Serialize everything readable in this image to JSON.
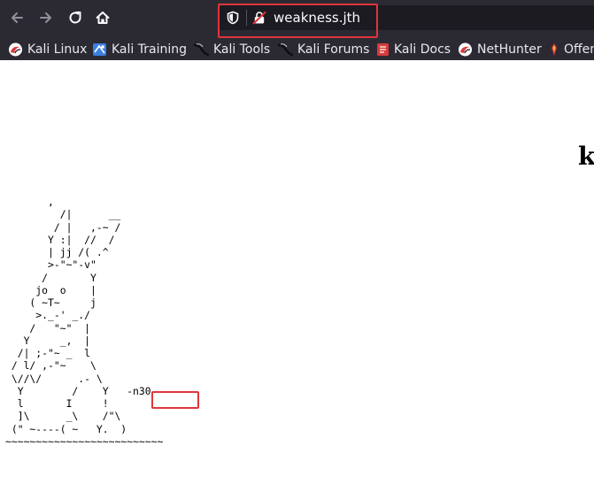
{
  "browser": {
    "nav": {
      "back_icon": "arrow-left-icon",
      "forward_icon": "arrow-right-icon",
      "reload_icon": "reload-icon",
      "home_icon": "home-icon"
    },
    "url_bar": {
      "url": "weakness.jth",
      "shield_icon": "shield-icon",
      "lock_icon": "insecure-lock-icon"
    },
    "bookmarks": [
      {
        "label": "Kali Linux",
        "icon": "kali-logo-icon"
      },
      {
        "label": "Kali Training",
        "icon": "kali-training-icon"
      },
      {
        "label": "Kali Tools",
        "icon": "kali-dragon-icon"
      },
      {
        "label": "Kali Forums",
        "icon": "kali-dragon-icon"
      },
      {
        "label": "Kali Docs",
        "icon": "kali-docs-icon"
      },
      {
        "label": "NetHunter",
        "icon": "kali-logo-icon"
      },
      {
        "label": "Offensive Security",
        "icon": "offsec-icon"
      }
    ],
    "colors": {
      "chrome_bg": "#2b2a33",
      "url_bg": "#1c1b22",
      "highlight": "#e0353b"
    }
  },
  "page": {
    "heading": "k",
    "ascii_art": "       ,\n         /|      __\n        / |   ,-~ /\n       Y :|  //  /\n       | jj /( .^\n       >-\"~\"-v\"\n      /       Y\n     jo  o    |\n    ( ~T~     j\n     >._-' _./\n    /   \"~\"  |\n   Y     _,  |\n  /| ;-\"~ _  l\n / l/ ,-\"~    \\\n \\//\\/      .- \\\n  Y        /    Y   -n30\n  l       I     !\n  ]\\      _\\    /\"\\\n (\" ~----( ~   Y.  )\n~~~~~~~~~~~~~~~~~~~~~~~~~~"
  }
}
